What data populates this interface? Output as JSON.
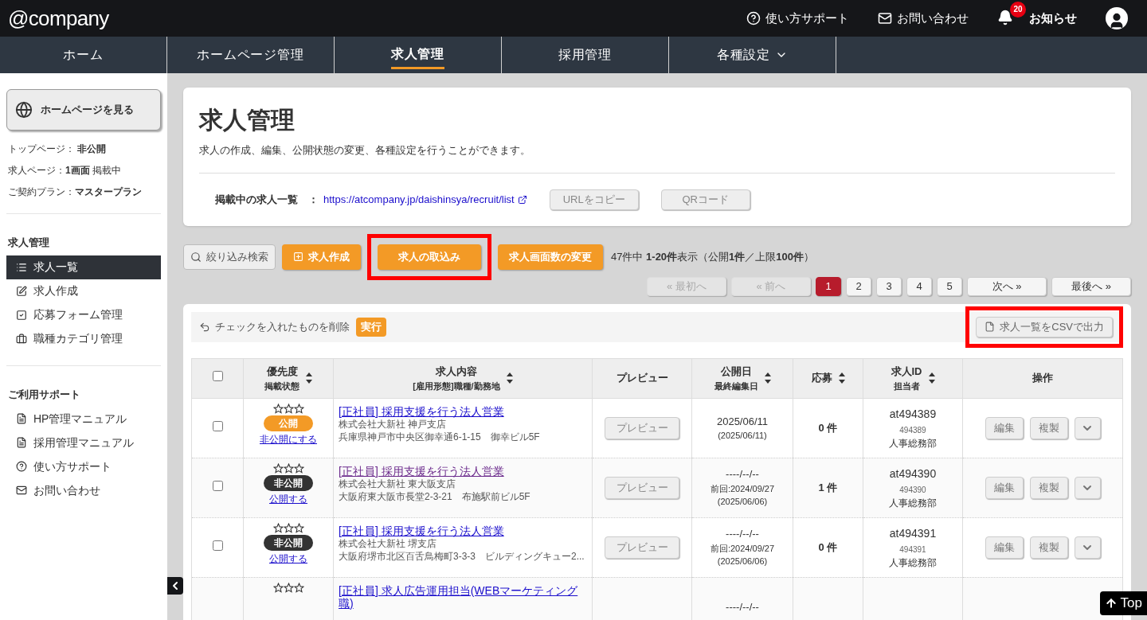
{
  "header": {
    "logo": "@company",
    "links": [
      {
        "kind": "help",
        "label": "使い方サポート"
      },
      {
        "kind": "mail",
        "label": "お問い合わせ"
      },
      {
        "kind": "bell",
        "label": "お知らせ",
        "badge": "20"
      }
    ]
  },
  "nav": [
    {
      "label": "ホーム",
      "selected": false,
      "has_menu": false
    },
    {
      "label": "ホームページ管理",
      "selected": false,
      "has_menu": false
    },
    {
      "label": "求人管理",
      "selected": true,
      "has_menu": false
    },
    {
      "label": "採用管理",
      "selected": false,
      "has_menu": false
    },
    {
      "label": "各種設定",
      "selected": false,
      "has_menu": true
    }
  ],
  "sidebar": {
    "view_button": "ホームページを見る",
    "status": [
      "トップページ： **非公開**",
      "求人ページ：**1画面** 掲載中",
      "ご契約プラン：**マスタープラン**"
    ],
    "sections": [
      {
        "title": "求人管理",
        "items": [
          {
            "kind": "list",
            "label": "求人一覧",
            "selected": true
          },
          {
            "kind": "edit",
            "label": "求人作成",
            "selected": false
          },
          {
            "kind": "check",
            "label": "応募フォーム管理",
            "selected": false
          },
          {
            "kind": "briefcase",
            "label": "職種カテゴリ管理",
            "selected": false
          }
        ]
      },
      {
        "title": "ご利用サポート",
        "items": [
          {
            "kind": "pdf",
            "label": "HP管理マニュアル",
            "selected": false
          },
          {
            "kind": "pdf",
            "label": "採用管理マニュアル",
            "selected": false
          },
          {
            "kind": "help",
            "label": "使い方サポート",
            "selected": false
          },
          {
            "kind": "mail",
            "label": "お問い合わせ",
            "selected": false
          }
        ]
      }
    ]
  },
  "page": {
    "title": "求人管理",
    "description": "求人の作成、編集、公開状態の変更、各種設定を行うことができます。",
    "url_label": "掲載中の求人一覧　：",
    "url": "https://atcompany.jp/daishinsya/recruit/list",
    "url_buttons": [
      "URLをコピー",
      "QRコード"
    ]
  },
  "toolbar": [
    {
      "kind": "filter",
      "label": "絞り込み検索",
      "highlighted": false
    },
    {
      "kind": "create",
      "label": "求人作成",
      "highlighted": false
    },
    {
      "kind": "import",
      "label": "求人の取込み",
      "highlighted": true
    },
    {
      "kind": "change",
      "label": "求人画面数の変更",
      "highlighted": false
    }
  ],
  "summary": "47件中 **1-20件**表示（公開**1件**／上限**100件**）",
  "pagination": [
    {
      "label": "« 最初へ",
      "disabled": true,
      "selected": false
    },
    {
      "label": "« 前へ",
      "disabled": true,
      "selected": false
    },
    {
      "label": "1",
      "disabled": false,
      "selected": true
    },
    {
      "label": "2",
      "disabled": false,
      "selected": false
    },
    {
      "label": "3",
      "disabled": false,
      "selected": false
    },
    {
      "label": "4",
      "disabled": false,
      "selected": false
    },
    {
      "label": "5",
      "disabled": false,
      "selected": false
    },
    {
      "label": "次へ »",
      "disabled": false,
      "selected": false
    },
    {
      "label": "最後へ »",
      "disabled": false,
      "selected": false
    }
  ],
  "bulk": {
    "label": "チェックを入れたものを削除",
    "run": "実行",
    "csv": "求人一覧をCSVで出力",
    "csv_highlighted": true
  },
  "select_all_checked": false,
  "columns": [
    {
      "title": "優先度",
      "subtitle": "掲載状態",
      "sortable": true
    },
    {
      "title": "求人内容",
      "subtitle": "[雇用形態]職種/勤務地",
      "sortable": true
    },
    {
      "title": "プレビュー",
      "sortable": false
    },
    {
      "title": "公開日",
      "subtitle": "最終編集日",
      "sortable": true
    },
    {
      "title": "応募",
      "sortable": true
    },
    {
      "title": "求人ID",
      "subtitle": "担当者",
      "sortable": true
    },
    {
      "title": "操作",
      "sortable": false
    }
  ],
  "rows": [
    {
      "checked": false,
      "stars": 0,
      "status": {
        "kind": "public",
        "label": "公開"
      },
      "toggle": "非公開にする",
      "title": "[正社員] 採用支援を行う法人営業",
      "visited": false,
      "company": "株式会社大新社 神戸支店",
      "address": "兵庫県神戸市中央区御幸通6-1-15　御幸ビル5F",
      "preview": "プレビュー",
      "dates": [
        "2025/06/11",
        "(2025/06/11)"
      ],
      "applies": "0 件",
      "id": "at494389",
      "sub_id": "494389",
      "owner": "人事総務部",
      "actions": [
        "編集",
        "複製"
      ]
    },
    {
      "checked": false,
      "stars": 0,
      "status": {
        "kind": "private",
        "label": "非公開"
      },
      "toggle": "公開する",
      "title": "[正社員] 採用支援を行う法人営業",
      "visited": true,
      "company": "株式会社大新社 東大阪支店",
      "address": "大阪府東大阪市長堂2-3-21　布施駅前ビル5F",
      "preview": "プレビュー",
      "dates": [
        "----/--/--",
        "前回:2024/09/27",
        "(2025/06/06)"
      ],
      "applies": "1 件",
      "id": "at494390",
      "sub_id": "494390",
      "owner": "人事総務部",
      "actions": [
        "編集",
        "複製"
      ]
    },
    {
      "checked": false,
      "stars": 0,
      "status": {
        "kind": "private",
        "label": "非公開"
      },
      "toggle": "公開する",
      "title": "[正社員] 採用支援を行う法人営業",
      "visited": false,
      "company": "株式会社大新社 堺支店",
      "address": "大阪府堺市北区百舌鳥梅町3-3-3　ビルディングキュー2...",
      "preview": "プレビュー",
      "dates": [
        "----/--/--",
        "前回:2024/09/27",
        "(2025/06/06)"
      ],
      "applies": "0 件",
      "id": "at494391",
      "sub_id": "494391",
      "owner": "人事総務部",
      "actions": [
        "編集",
        "複製"
      ]
    },
    {
      "stars": 0,
      "title": "[正社員] 求人広告運用担当(WEBマーケティング職)",
      "visited": false,
      "dates": [
        "----/--/--"
      ]
    }
  ],
  "back_to_top": "Top"
}
